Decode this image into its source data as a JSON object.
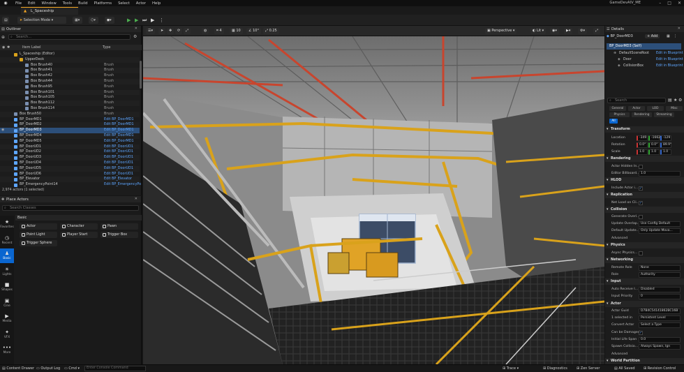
{
  "menu": {
    "items": [
      "File",
      "Edit",
      "Window",
      "Tools",
      "Build",
      "Platforms",
      "Select",
      "Actor",
      "Help"
    ],
    "project": "GameDevAIV_ME"
  },
  "tab": {
    "label": "L_Spaceship"
  },
  "toolbar": {
    "mode": "Selection Mode"
  },
  "outliner": {
    "title": "Outliner",
    "search_placeholder": "Search...",
    "col_label": "Item Label",
    "col_type": "Type",
    "rows": [
      {
        "label": "L_Spaceship (Editor)",
        "type": "",
        "indent": 1,
        "kind": "level"
      },
      {
        "label": "UpperDeck",
        "type": "",
        "indent": 2,
        "kind": "folder"
      },
      {
        "label": "Box Brush40",
        "type": "Brush",
        "indent": 3,
        "kind": "brush"
      },
      {
        "label": "Box Brush41",
        "type": "Brush",
        "indent": 3,
        "kind": "brush"
      },
      {
        "label": "Box Brush42",
        "type": "Brush",
        "indent": 3,
        "kind": "brush"
      },
      {
        "label": "Box Brush44",
        "type": "Brush",
        "indent": 3,
        "kind": "brush"
      },
      {
        "label": "Box Brush95",
        "type": "Brush",
        "indent": 3,
        "kind": "brush"
      },
      {
        "label": "Box Brush101",
        "type": "Brush",
        "indent": 3,
        "kind": "brush"
      },
      {
        "label": "Box Brush105",
        "type": "Brush",
        "indent": 3,
        "kind": "brush"
      },
      {
        "label": "Box Brush112",
        "type": "Brush",
        "indent": 3,
        "kind": "brush"
      },
      {
        "label": "Box Brush114",
        "type": "Brush",
        "indent": 3,
        "kind": "brush"
      },
      {
        "label": "Box Brush50",
        "type": "Brush",
        "indent": 1,
        "kind": "brush"
      },
      {
        "label": "BP_DoorMD1",
        "type": "Edit BP_DoorMD1",
        "indent": 1,
        "kind": "bp"
      },
      {
        "label": "BP_DoorMD2",
        "type": "Edit BP_DoorMD1",
        "indent": 1,
        "kind": "bp"
      },
      {
        "label": "BP_DoorMD3",
        "type": "Edit BP_DoorMD1",
        "indent": 1,
        "kind": "bp",
        "selected": true
      },
      {
        "label": "BP_DoorMD4",
        "type": "Edit BP_DoorMD1",
        "indent": 1,
        "kind": "bp"
      },
      {
        "label": "BP_DoorMD5",
        "type": "Edit BP_DoorMD1",
        "indent": 1,
        "kind": "bp"
      },
      {
        "label": "BP_DoorUD1",
        "type": "Edit BP_DoorUD1",
        "indent": 1,
        "kind": "bp"
      },
      {
        "label": "BP_DoorUD2",
        "type": "Edit BP_DoorUD1",
        "indent": 1,
        "kind": "bp"
      },
      {
        "label": "BP_DoorUD3",
        "type": "Edit BP_DoorUD1",
        "indent": 1,
        "kind": "bp"
      },
      {
        "label": "BP_DoorUD4",
        "type": "Edit BP_DoorUD1",
        "indent": 1,
        "kind": "bp"
      },
      {
        "label": "BP_DoorUD5",
        "type": "Edit BP_DoorUD1",
        "indent": 1,
        "kind": "bp"
      },
      {
        "label": "BP_DoorUD6",
        "type": "Edit BP_DoorUD1",
        "indent": 1,
        "kind": "bp"
      },
      {
        "label": "BP_Elevator",
        "type": "Edit BP_Elevator",
        "indent": 1,
        "kind": "bp"
      },
      {
        "label": "BP_EmergencyPoint14",
        "type": "Edit BP_EmergencyPo",
        "indent": 1,
        "kind": "bp"
      }
    ],
    "status": "2,974 actors (1 selected)"
  },
  "place": {
    "title": "Place Actors",
    "search_placeholder": "Search Classes",
    "section": "Basic",
    "categories": [
      {
        "label": "Favorites",
        "icon": "★"
      },
      {
        "label": "Recent",
        "icon": "◷"
      },
      {
        "label": "Basic",
        "icon": "♟",
        "on": true
      },
      {
        "label": "Lights",
        "icon": "☀"
      },
      {
        "label": "Shapes",
        "icon": "■"
      },
      {
        "label": "Cine",
        "icon": "▣"
      },
      {
        "label": "Media",
        "icon": "▶"
      },
      {
        "label": "VFX",
        "icon": "✦"
      },
      {
        "label": "More",
        "icon": "•••"
      }
    ],
    "actors": [
      "Actor",
      "Character",
      "Pawn",
      "Point Light",
      "Player Start",
      "Trigger Box",
      "Trigger Sphere"
    ]
  },
  "viewport": {
    "perspective": "Perspective",
    "lit": "Lit",
    "snap1": "10",
    "snap2": "10°",
    "snap3": "0.25",
    "count": "4"
  },
  "details": {
    "title": "Details",
    "object": "BP_DoorMD3",
    "add": "+ Add",
    "self": "BP_DoorMD3 (Self)",
    "components": [
      {
        "name": "DefaultSceneRoot",
        "link": "Edit in Blueprint"
      },
      {
        "name": "Door",
        "link": "Edit in Blueprint"
      },
      {
        "name": "CollisionBox",
        "link": "Edit in Blueprint"
      }
    ],
    "search_placeholder": "Search",
    "tabs1": [
      "General",
      "Actor",
      "LOD",
      "Misc"
    ],
    "tabs2": [
      "Physics",
      "Rendering",
      "Streaming"
    ],
    "tabs3": [
      "All"
    ],
    "transform": {
      "title": "Transform",
      "location": "Location",
      "loc": [
        "-349",
        "-1662",
        "-129"
      ],
      "rotation": "Rotation",
      "rot": [
        "0.0°",
        "0.0°",
        "89.9°"
      ],
      "scale": "Scale",
      "scl": [
        "1.0",
        "1.0",
        "1.0"
      ]
    },
    "rendering": {
      "title": "Rendering",
      "hidden": "Actor Hidden In...",
      "billboard": "Editor Billboard...",
      "billboard_val": "1.0"
    },
    "hlod": {
      "title": "HLOD",
      "include": "Include Actor i..."
    },
    "replication": {
      "title": "Replication",
      "netload": "Net Load on Cli..."
    },
    "collision": {
      "title": "Collision",
      "generate": "Generate Overl...",
      "update": "Update Overlap...",
      "update_val": "Use Config Default",
      "defupdate": "Default Update...",
      "defupdate_val": "Only Update Mova...",
      "advanced": "Advanced"
    },
    "physics": {
      "title": "Physics",
      "async": "Async Physics..."
    },
    "networking": {
      "title": "Networking",
      "remote": "Remote Role",
      "remote_val": "None",
      "role": "Role",
      "role_val": "Authority"
    },
    "input": {
      "title": "Input",
      "auto": "Auto Receive I...",
      "auto_val": "Disabled",
      "priority": "Input Priority",
      "priority_val": "0"
    },
    "actor": {
      "title": "Actor",
      "guid": "Actor Guid",
      "guid_val": "D7B4C54141862BC16B",
      "selected": "1 selected in",
      "selected_val": "Persistent Level",
      "convert": "Convert Actor",
      "convert_val": "Select a Type",
      "damage": "Can be Damaged",
      "life": "Initial Life Span",
      "life_val": "0.0",
      "spawn": "Spawn Collisio...",
      "spawn_val": "Always Spawn, Ign",
      "advanced": "Advanced"
    },
    "worldpartition": "World Partition"
  },
  "bottom": {
    "drawer": "Content Drawer",
    "log": "Output Log",
    "cmd": "Cmd",
    "console": "Enter Console Command",
    "trace": "Trace",
    "diag": "Diagnostics",
    "zen": "Zen Server",
    "saved": "All Saved",
    "rev": "Revision Control"
  },
  "colors": {
    "accent": "#f5a623",
    "select": "#2c4f7a",
    "link": "#5ea6ff"
  }
}
